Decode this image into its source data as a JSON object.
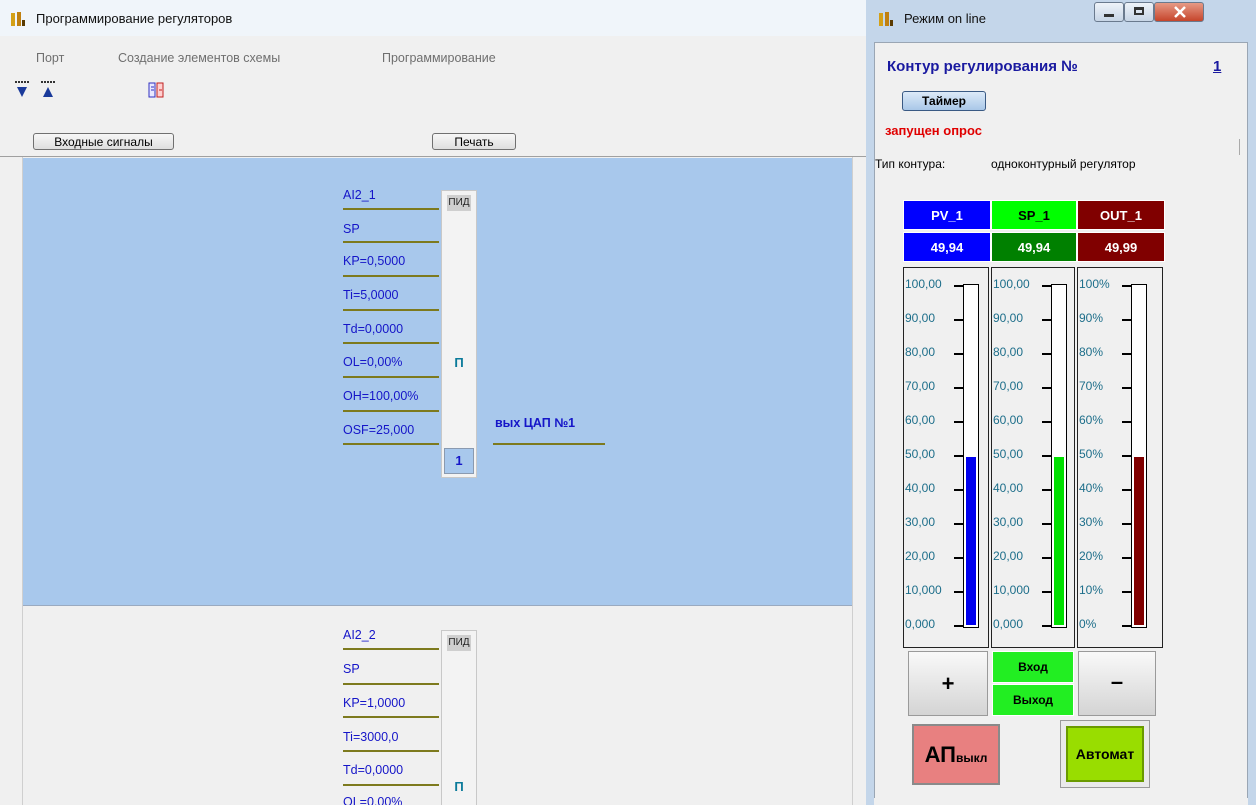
{
  "main_window": {
    "title": "Программирование регуляторов",
    "menu": [
      "Порт",
      "Создание элементов схемы",
      "Программирование"
    ],
    "toolbar_icons": [
      "download-icon",
      "upload-icon",
      "scheme-icon"
    ],
    "buttons": {
      "input_signals": "Входные сигналы",
      "print": "Печать"
    },
    "blocks": [
      {
        "input": "AI2_1",
        "params": [
          "SP",
          "KP=0,5000",
          "Ti=5,0000",
          "Td=0,0000",
          "OL=0,00%",
          "OH=100,00%",
          "OSF=25,000"
        ],
        "type": "ПИД",
        "mode": "П",
        "number": "1",
        "output": "вых ЦАП №1",
        "selected": true
      },
      {
        "input": "AI2_2",
        "params": [
          "SP",
          "KP=1,0000",
          "Ti=3000,0",
          "Td=0,0000",
          "OL=0,00%"
        ],
        "type": "ПИД",
        "mode": "П",
        "selected": false
      }
    ]
  },
  "online_window": {
    "title": "Режим on line",
    "contour_label": "Контур регулирования №",
    "contour_number": "1",
    "timer_button": "Таймер",
    "status": "запущен опрос",
    "type_label": "Тип контура:",
    "type_value": "одноконтурный регулятор",
    "gauges": [
      {
        "name": "PV_1",
        "value": "49,94",
        "level": 0.4994,
        "header_color": "#0000ff",
        "header_text_color": "#ffffff",
        "fill_color": "#0000ee",
        "scale": [
          "100,00",
          "90,00",
          "80,00",
          "70,00",
          "60,00",
          "50,00",
          "40,00",
          "30,00",
          "20,00",
          "10,000",
          "0,000"
        ]
      },
      {
        "name": "SP_1",
        "value": "49,94",
        "level": 0.4994,
        "header_color": "#00ff00",
        "header_text_color": "#000000",
        "value_bg": "#008000",
        "value_text_color": "#ffffff",
        "fill_color": "#00e000",
        "scale": [
          "100,00",
          "90,00",
          "80,00",
          "70,00",
          "60,00",
          "50,00",
          "40,00",
          "30,00",
          "20,00",
          "10,000",
          "0,000"
        ]
      },
      {
        "name": "OUT_1",
        "value": "49,99",
        "level": 0.4999,
        "header_color": "#800000",
        "header_text_color": "#ffffff",
        "fill_color": "#800000",
        "scale": [
          "100%",
          "90%",
          "80%",
          "70%",
          "60%",
          "50%",
          "40%",
          "30%",
          "20%",
          "10%",
          "0%"
        ]
      }
    ],
    "plus_button": "+",
    "minus_button": "–",
    "input_label": "Вход",
    "output_label": "Выход",
    "ap_button_main": "АП",
    "ap_button_sub": "выкл",
    "auto_button": "Автомат",
    "colors": {
      "ap_bg": "#e88080",
      "auto_bg": "#99dd00",
      "status": "#e00000"
    }
  }
}
